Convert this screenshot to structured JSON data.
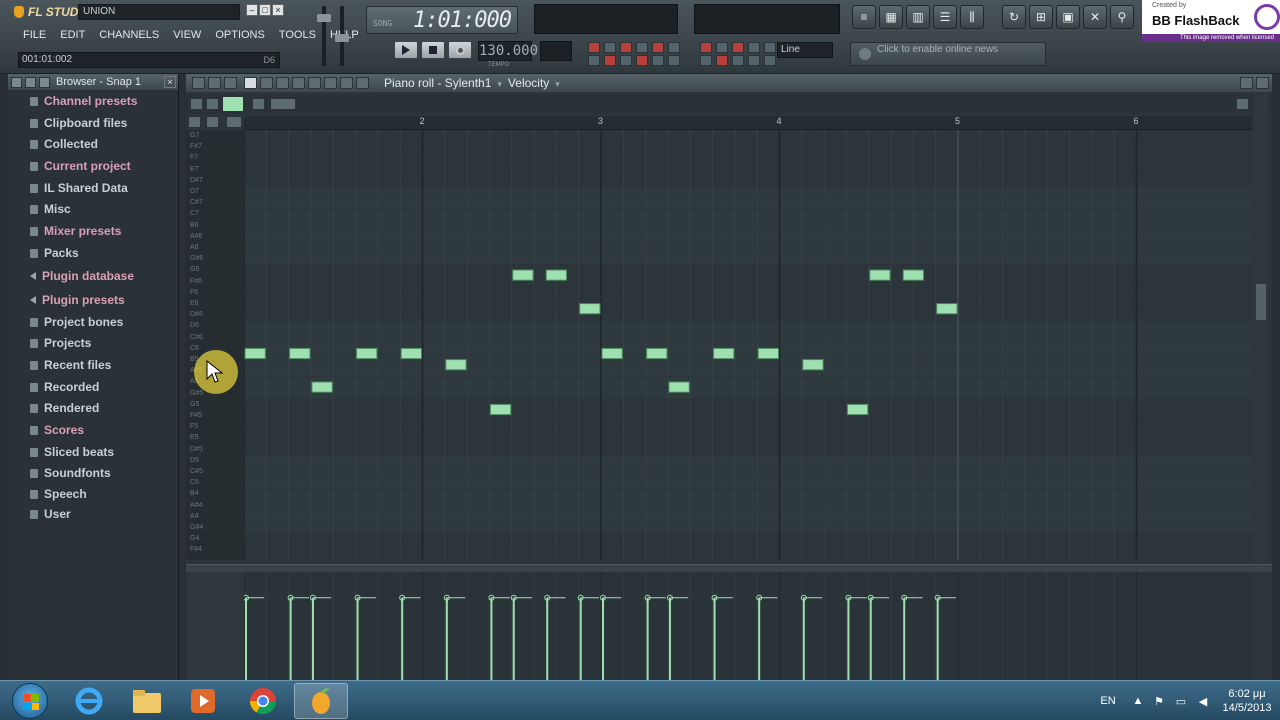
{
  "app": {
    "logo_text": "FL STUDIO",
    "song_name": "UNION",
    "menu": [
      "FILE",
      "EDIT",
      "CHANNELS",
      "VIEW",
      "OPTIONS",
      "TOOLS",
      "HELP"
    ],
    "time_position": "001:01:002",
    "time_hint": "D6",
    "lcd_time": "1:01:000",
    "tempo": "130.000",
    "tempo_label": "TEMPO",
    "snap": "Line",
    "news": "Click to enable online news",
    "watermark": {
      "top": "Created by",
      "name": "BB FlashBack",
      "bottom": "This image removed when licensed"
    }
  },
  "browser": {
    "title": "Browser - Snap 1",
    "items": [
      {
        "label": "Channel presets",
        "color": "#d9a0b5",
        "icon": "folder-icon"
      },
      {
        "label": "Clipboard files",
        "color": "#c7d1d5",
        "icon": "folder-icon"
      },
      {
        "label": "Collected",
        "color": "#c7d1d5",
        "icon": "folder-icon"
      },
      {
        "label": "Current project",
        "color": "#d9a0b5",
        "icon": "folder-icon"
      },
      {
        "label": "IL Shared Data",
        "color": "#c7d1d5",
        "icon": "folder-icon"
      },
      {
        "label": "Misc",
        "color": "#c7d1d5",
        "icon": "folder-icon"
      },
      {
        "label": "Mixer presets",
        "color": "#d9a0b5",
        "icon": "folder-icon"
      },
      {
        "label": "Packs",
        "color": "#c7d1d5",
        "icon": "folder-icon"
      },
      {
        "label": "Plugin database",
        "color": "#d9a0b5",
        "icon": "arrow-icon"
      },
      {
        "label": "Plugin presets",
        "color": "#d9a0b5",
        "icon": "arrow-icon"
      },
      {
        "label": "Project bones",
        "color": "#c7d1d5",
        "icon": "folder-icon"
      },
      {
        "label": "Projects",
        "color": "#c7d1d5",
        "icon": "folder-icon"
      },
      {
        "label": "Recent files",
        "color": "#c7d1d5",
        "icon": "folder-icon"
      },
      {
        "label": "Recorded",
        "color": "#c7d1d5",
        "icon": "folder-icon"
      },
      {
        "label": "Rendered",
        "color": "#c7d1d5",
        "icon": "folder-icon"
      },
      {
        "label": "Scores",
        "color": "#d9a0b5",
        "icon": "folder-icon"
      },
      {
        "label": "Sliced beats",
        "color": "#c7d1d5",
        "icon": "folder-icon"
      },
      {
        "label": "Soundfonts",
        "color": "#c7d1d5",
        "icon": "folder-icon"
      },
      {
        "label": "Speech",
        "color": "#c7d1d5",
        "icon": "folder-icon"
      },
      {
        "label": "User",
        "color": "#c7d1d5",
        "icon": "folder-icon"
      }
    ]
  },
  "piano_roll": {
    "title": "Piano roll - Sylenth1",
    "target": "Velocity",
    "bar_numbers": [
      "2",
      "3",
      "4",
      "5",
      "6"
    ],
    "key_labels": [
      "G7",
      "F#7",
      "F7",
      "E7",
      "D#7",
      "D7",
      "C#7",
      "C7",
      "B6",
      "A#6",
      "A6",
      "G#6",
      "G6",
      "F#6",
      "F6",
      "E6",
      "D#6",
      "D6",
      "C#6",
      "C6",
      "B5",
      "A#5",
      "A5",
      "G#5",
      "G5",
      "F#5",
      "F5",
      "E5",
      "D#5",
      "D5",
      "C#5",
      "C5",
      "B4",
      "A#4",
      "A4",
      "G#4",
      "G4",
      "F#4"
    ],
    "note_color": "#9fe0b0",
    "notes": [
      {
        "start": 0.0,
        "length": 0.125,
        "pitch": 0
      },
      {
        "start": 0.25,
        "length": 0.125,
        "pitch": 0
      },
      {
        "start": 0.375,
        "length": 0.125,
        "pitch": -3
      },
      {
        "start": 0.625,
        "length": 0.125,
        "pitch": 0
      },
      {
        "start": 0.875,
        "length": 0.125,
        "pitch": 0
      },
      {
        "start": 1.125,
        "length": 0.125,
        "pitch": -1
      },
      {
        "start": 1.375,
        "length": 0.125,
        "pitch": -5
      },
      {
        "start": 1.5,
        "length": 0.125,
        "pitch": 7
      },
      {
        "start": 1.6875,
        "length": 0.125,
        "pitch": 7
      },
      {
        "start": 1.875,
        "length": 0.125,
        "pitch": 4
      },
      {
        "start": 2.0,
        "length": 0.125,
        "pitch": 0
      },
      {
        "start": 2.25,
        "length": 0.125,
        "pitch": 0
      },
      {
        "start": 2.375,
        "length": 0.125,
        "pitch": -3
      },
      {
        "start": 2.625,
        "length": 0.125,
        "pitch": 0
      },
      {
        "start": 2.875,
        "length": 0.125,
        "pitch": 0
      },
      {
        "start": 3.125,
        "length": 0.125,
        "pitch": -1
      },
      {
        "start": 3.375,
        "length": 0.125,
        "pitch": -5
      },
      {
        "start": 3.5,
        "length": 0.125,
        "pitch": 7
      },
      {
        "start": 3.6875,
        "length": 0.125,
        "pitch": 7
      },
      {
        "start": 3.875,
        "length": 0.125,
        "pitch": 4
      }
    ],
    "velocity_events": [
      0.0,
      0.25,
      0.375,
      0.625,
      0.875,
      1.125,
      1.375,
      1.5,
      1.6875,
      1.875,
      2.0,
      2.25,
      2.375,
      2.625,
      2.875,
      3.125,
      3.375,
      3.5,
      3.6875,
      3.875
    ],
    "velocity_level": 0.78
  },
  "taskbar": {
    "language": "EN",
    "time": "6:02 μμ",
    "date": "14/5/2013"
  }
}
